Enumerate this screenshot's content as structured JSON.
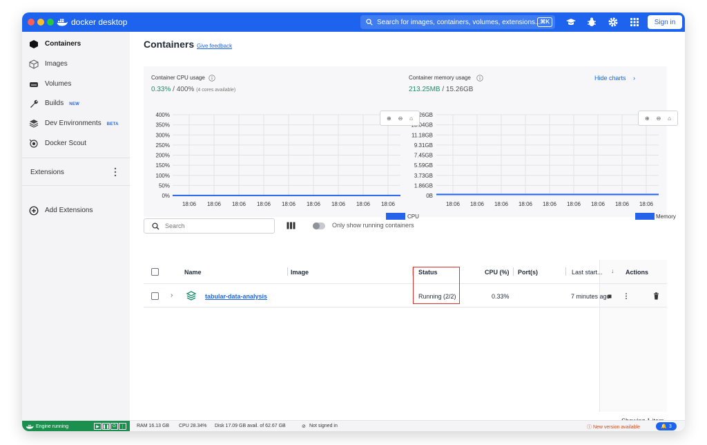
{
  "app": {
    "name": "docker desktop",
    "search_placeholder": "Search for images, containers, volumes, extensions...",
    "search_shortcut": "⌘K",
    "sign_in": "Sign in"
  },
  "sidebar": {
    "items": [
      {
        "label": "Containers",
        "icon": "container-icon",
        "active": true
      },
      {
        "label": "Images",
        "icon": "image-icon"
      },
      {
        "label": "Volumes",
        "icon": "volume-icon"
      },
      {
        "label": "Builds",
        "icon": "wrench-icon",
        "badge": "NEW"
      },
      {
        "label": "Dev Environments",
        "icon": "dev-env-icon",
        "badge": "BETA"
      },
      {
        "label": "Docker Scout",
        "icon": "scout-icon"
      }
    ],
    "extensions_title": "Extensions",
    "add_extensions": "Add Extensions"
  },
  "main": {
    "title": "Containers",
    "feedback": "Give feedback",
    "hide_charts": "Hide charts",
    "search_placeholder": "Search",
    "running_toggle_label": "Only show running containers",
    "showing": "Showing 1 item"
  },
  "cpu_chart": {
    "label": "Container CPU usage",
    "value": "0.33%",
    "max": "/ 400%",
    "sub": "(4 cores available)",
    "legend": "CPU"
  },
  "mem_chart": {
    "label": "Container memory usage",
    "value": "213.25MB",
    "max": "/ 15.26GB",
    "legend": "Memory"
  },
  "chart_data": [
    {
      "type": "line",
      "title": "Container CPU usage",
      "y_ticks": [
        "400%",
        "350%",
        "300%",
        "250%",
        "200%",
        "150%",
        "100%",
        "50%",
        "0%"
      ],
      "ylim": [
        0,
        400
      ],
      "x": [
        "18:06",
        "18:06",
        "18:06",
        "18:06",
        "18:06",
        "18:06",
        "18:06",
        "18:06",
        "18:06"
      ],
      "series": [
        {
          "name": "CPU",
          "values": [
            0.33,
            0.33,
            0.33,
            0.33,
            0.33,
            0.33,
            0.33,
            0.33,
            0.33
          ]
        }
      ],
      "legend": "bottom-right",
      "color": "#2563eb"
    },
    {
      "type": "line",
      "title": "Container memory usage",
      "y_ticks": [
        "15.26GB",
        "13.04GB",
        "11.18GB",
        "9.31GB",
        "7.45GB",
        "5.59GB",
        "3.73GB",
        "1.86GB",
        "0B"
      ],
      "ylim": [
        0,
        15.26
      ],
      "x": [
        "18:06",
        "18:06",
        "18:06",
        "18:06",
        "18:06",
        "18:06",
        "18:06",
        "18:06",
        "18:06"
      ],
      "series": [
        {
          "name": "Memory",
          "values": [
            0.213,
            0.213,
            0.213,
            0.213,
            0.213,
            0.213,
            0.213,
            0.213,
            0.213
          ]
        }
      ],
      "legend": "bottom-right",
      "color": "#2563eb"
    }
  ],
  "table": {
    "headers": {
      "name": "Name",
      "image": "Image",
      "status": "Status",
      "cpu": "CPU (%)",
      "ports": "Port(s)",
      "last_started": "Last start...",
      "actions": "Actions"
    },
    "rows": [
      {
        "name": "tabular-data-analysis",
        "image": "",
        "status": "Running (2/2)",
        "cpu": "0.33%",
        "ports": "",
        "last_started": "7 minutes ago"
      }
    ]
  },
  "footer": {
    "engine": "Engine running",
    "ram": "RAM 16.13 GB",
    "cpu": "CPU 28.34%",
    "disk": "Disk 17.09 GB avail. of 62.67 GB",
    "signed": "Not signed in",
    "new_version": "New version available",
    "notifications": "3"
  },
  "colors": {
    "brand": "#1d63ed",
    "engine": "#1a8f4e",
    "status_highlight": "#e0302a"
  }
}
